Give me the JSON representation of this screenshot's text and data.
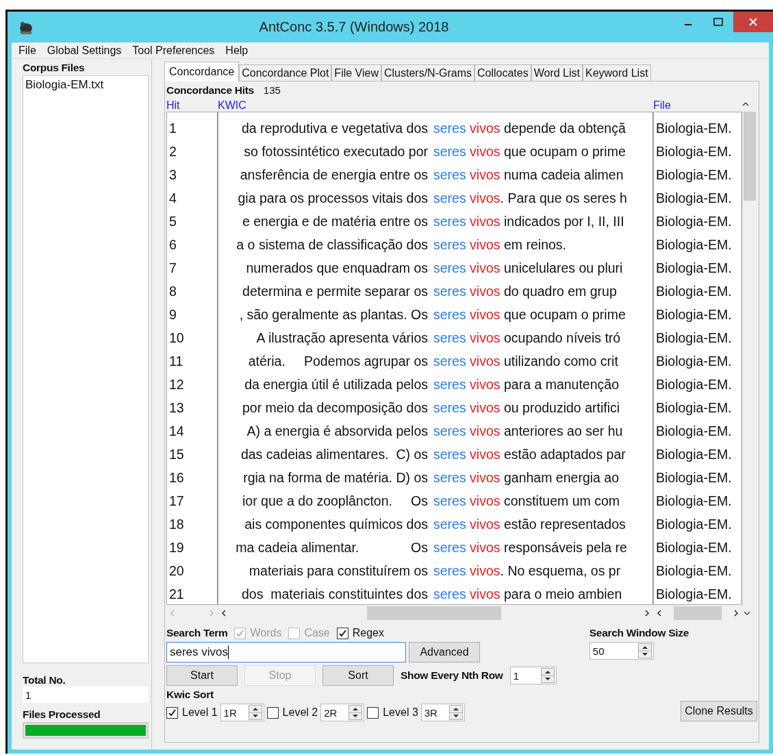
{
  "window": {
    "title": "AntConc 3.5.7 (Windows) 2018"
  },
  "menu": [
    "File",
    "Global Settings",
    "Tool Preferences",
    "Help"
  ],
  "corpus_files": {
    "label": "Corpus Files",
    "items": [
      "Biologia-EM.txt"
    ]
  },
  "total": {
    "label": "Total No.",
    "value": "1"
  },
  "files_processed": {
    "label": "Files Processed",
    "level": 1
  },
  "tabs": [
    {
      "label": "Concordance",
      "selected": true
    },
    {
      "label": "Concordance Plot",
      "selected": false
    },
    {
      "label": "File View",
      "selected": false
    },
    {
      "label": "Clusters/N-Grams",
      "selected": false
    },
    {
      "label": "Collocates",
      "selected": false
    },
    {
      "label": "Word List",
      "selected": false
    },
    {
      "label": "Keyword List",
      "selected": false
    }
  ],
  "hits": {
    "label": "Concordance Hits",
    "value": "135"
  },
  "columns": [
    "Hit",
    "KWIC",
    "File"
  ],
  "rows": [
    {
      "hit": "1",
      "left": "da reprodutiva e vegetativa dos",
      "key1": "seres",
      "key2": "vivos",
      "right": " depende da obtençã",
      "file": "Biologia-EM."
    },
    {
      "hit": "2",
      "left": "so fotossintético executado por",
      "key1": "seres",
      "key2": "vivos",
      "right": " que ocupam o prime",
      "file": "Biologia-EM."
    },
    {
      "hit": "3",
      "left": "ansferência de energia entre os",
      "key1": "seres",
      "key2": "vivos",
      "right": " numa cadeia alimen",
      "file": "Biologia-EM."
    },
    {
      "hit": "4",
      "left": "gia para os processos vitais dos",
      "key1": "seres",
      "key2": "vivos",
      "right": ". Para que os seres h",
      "file": "Biologia-EM."
    },
    {
      "hit": "5",
      "left": "e energia e de matéria entre os",
      "key1": "seres",
      "key2": "vivos",
      "right": " indicados por I, II, III",
      "file": "Biologia-EM."
    },
    {
      "hit": "6",
      "left": "a o sistema de classificação dos",
      "key1": "seres",
      "key2": "vivos",
      "right": " em reinos.",
      "file": "Biologia-EM."
    },
    {
      "hit": "7",
      "left": "numerados que enquadram os",
      "key1": "seres",
      "key2": "vivos",
      "right": " unicelulares ou pluri",
      "file": "Biologia-EM."
    },
    {
      "hit": "8",
      "left": "determina e permite separar os",
      "key1": "seres",
      "key2": "vivos",
      "right": " do quadro em grup",
      "file": "Biologia-EM."
    },
    {
      "hit": "9",
      "left": ", são geralmente as plantas. Os",
      "key1": "seres",
      "key2": "vivos",
      "right": " que ocupam o prime",
      "file": "Biologia-EM."
    },
    {
      "hit": "10",
      "left": "A ilustração apresenta vários",
      "key1": "seres",
      "key2": "vivos",
      "right": " ocupando níveis tró",
      "file": "Biologia-EM."
    },
    {
      "hit": "11",
      "left": "atéria.     Podemos agrupar os",
      "key1": "seres",
      "key2": "vivos",
      "right": " utilizando como crit",
      "file": "Biologia-EM."
    },
    {
      "hit": "12",
      "left": "da energia útil é utilizada pelos",
      "key1": "seres",
      "key2": "vivos",
      "right": " para a manutenção",
      "file": "Biologia-EM."
    },
    {
      "hit": "13",
      "left": "por meio da decomposição dos",
      "key1": "seres",
      "key2": "vivos",
      "right": " ou produzido artifici",
      "file": "Biologia-EM."
    },
    {
      "hit": "14",
      "left": "A) a energia é absorvida pelos",
      "key1": "seres",
      "key2": "vivos",
      "right": " anteriores ao ser hu",
      "file": "Biologia-EM."
    },
    {
      "hit": "15",
      "left": "das cadeias alimentares.  C) os",
      "key1": "seres",
      "key2": "vivos",
      "right": " estão adaptados par",
      "file": "Biologia-EM."
    },
    {
      "hit": "16",
      "left": "rgia na forma de matéria. D) os",
      "key1": "seres",
      "key2": "vivos",
      "right": " ganham energia ao",
      "file": "Biologia-EM."
    },
    {
      "hit": "17",
      "left": "ior que a do zooplâncton.     Os",
      "key1": "seres",
      "key2": "vivos",
      "right": " constituem um com",
      "file": "Biologia-EM."
    },
    {
      "hit": "18",
      "left": "ais componentes químicos dos",
      "key1": "seres",
      "key2": "vivos",
      "right": " estão representados",
      "file": "Biologia-EM."
    },
    {
      "hit": "19",
      "left": "ma cadeia alimentar.              Os",
      "key1": "seres",
      "key2": "vivos",
      "right": " responsáveis pela re",
      "file": "Biologia-EM."
    },
    {
      "hit": "20",
      "left": "materiais para constituírem os",
      "key1": "seres",
      "key2": "vivos",
      "right": ". No esquema, os pr",
      "file": "Biologia-EM."
    },
    {
      "hit": "21",
      "left": "dos  materiais constituintes dos",
      "key1": "seres",
      "key2": "vivos",
      "right": " para o meio ambien",
      "file": "Biologia-EM."
    }
  ],
  "search": {
    "label": "Search Term",
    "options": [
      {
        "label": "Words",
        "checked": true,
        "disabled": true
      },
      {
        "label": "Case",
        "checked": false,
        "disabled": true
      },
      {
        "label": "Regex",
        "checked": true,
        "disabled": false
      }
    ],
    "value": "seres vivos",
    "advanced": "Advanced"
  },
  "window_size": {
    "label": "Search Window Size",
    "value": "50"
  },
  "buttons": [
    {
      "label": "Start",
      "disabled": false
    },
    {
      "label": "Stop",
      "disabled": true
    },
    {
      "label": "Sort",
      "disabled": false
    }
  ],
  "nth_row": {
    "label": "Show Every Nth Row",
    "value": "1"
  },
  "kwic_sort": {
    "label": "Kwic Sort",
    "levels": [
      {
        "label": "Level 1",
        "checked": true,
        "value": "1R"
      },
      {
        "label": "Level 2",
        "checked": false,
        "value": "2R"
      },
      {
        "label": "Level 3",
        "checked": false,
        "value": "3R"
      }
    ]
  },
  "clone": "Clone Results"
}
